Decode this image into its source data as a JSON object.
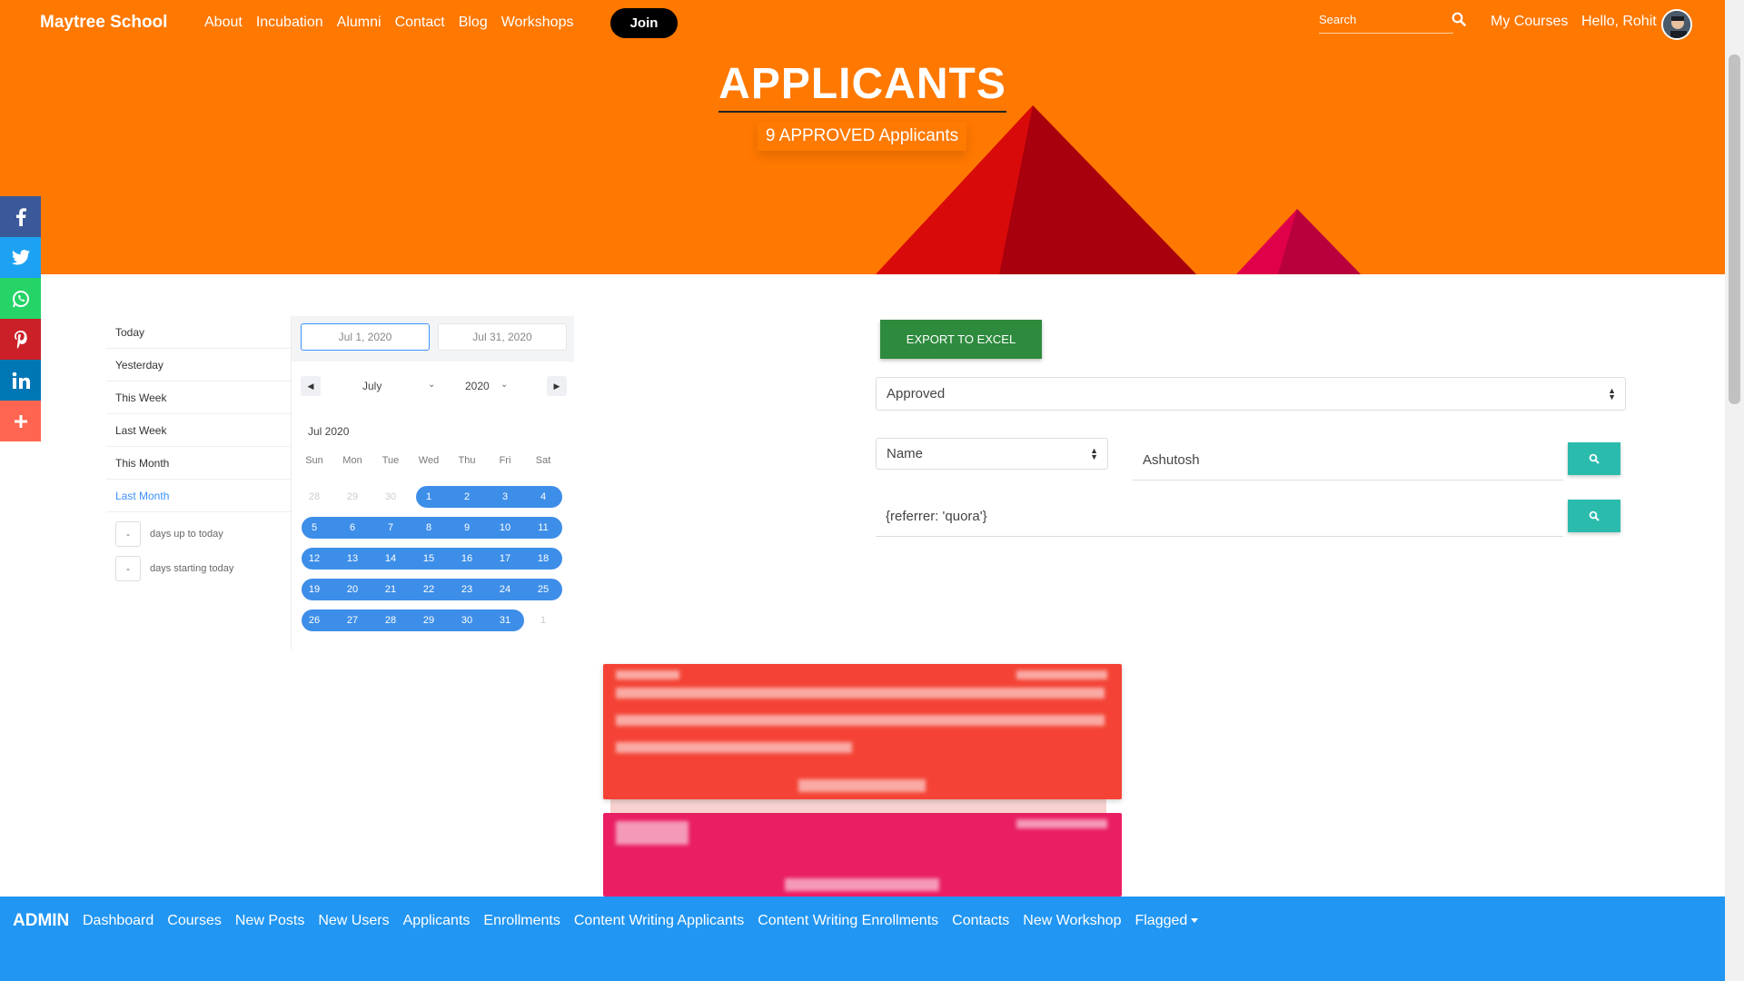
{
  "nav": {
    "brand": "Maytree School",
    "links": [
      "About",
      "Incubation",
      "Alumni",
      "Contact",
      "Blog",
      "Workshops"
    ],
    "join": "Join",
    "search_placeholder": "Search",
    "my_courses": "My Courses",
    "hello": "Hello, Rohit"
  },
  "hero": {
    "title": "APPLICANTS",
    "subtitle": "9 APPROVED Applicants"
  },
  "social": [
    {
      "icon": "facebook-icon",
      "glyph": "f",
      "color": "#3b5998"
    },
    {
      "icon": "twitter-icon",
      "glyph": "t",
      "color": "#1da1f2"
    },
    {
      "icon": "whatsapp-icon",
      "glyph": "w",
      "color": "#25d366"
    },
    {
      "icon": "pinterest-icon",
      "glyph": "p",
      "color": "#cb2027"
    },
    {
      "icon": "linkedin-icon",
      "glyph": "in",
      "color": "#0077b5"
    },
    {
      "icon": "more-icon",
      "glyph": "+",
      "color": "#ff6550"
    }
  ],
  "picker": {
    "ranges": [
      "Today",
      "Yesterday",
      "This Week",
      "Last Week",
      "This Month",
      "Last Month"
    ],
    "active_range": "Last Month",
    "days_up": "days up to today",
    "days_start": "days starting today",
    "days_value": "-",
    "start_date": "Jul 1, 2020",
    "end_date": "Jul 31, 2020",
    "month": "July",
    "year": "2020",
    "month_label": "Jul 2020",
    "weekdays": [
      "Sun",
      "Mon",
      "Tue",
      "Wed",
      "Thu",
      "Fri",
      "Sat"
    ],
    "weeks": [
      [
        "28",
        "29",
        "30",
        "1",
        "2",
        "3",
        "4"
      ],
      [
        "5",
        "6",
        "7",
        "8",
        "9",
        "10",
        "11"
      ],
      [
        "12",
        "13",
        "14",
        "15",
        "16",
        "17",
        "18"
      ],
      [
        "19",
        "20",
        "21",
        "22",
        "23",
        "24",
        "25"
      ],
      [
        "26",
        "27",
        "28",
        "29",
        "30",
        "31",
        "1"
      ]
    ]
  },
  "filters": {
    "export": "EXPORT TO EXCEL",
    "status": "Approved",
    "field": "Name",
    "name_value": "Ashutosh",
    "query_value": "{referrer: 'quora'}"
  },
  "admin": {
    "title": "ADMIN",
    "links": [
      "Dashboard",
      "Courses",
      "New Posts",
      "New Users",
      "Applicants",
      "Enrollments",
      "Content Writing Applicants",
      "Content Writing Enrollments",
      "Contacts",
      "New Workshop",
      "Flagged"
    ]
  },
  "colors": {
    "header": "#ff7800",
    "admin_bar": "#2196f3",
    "card_red": "#f44336",
    "card_pink": "#e91e63",
    "export_button": "#2e8b3e",
    "search_button": "#2bbbad",
    "range_selected": "#3d8ee8"
  }
}
